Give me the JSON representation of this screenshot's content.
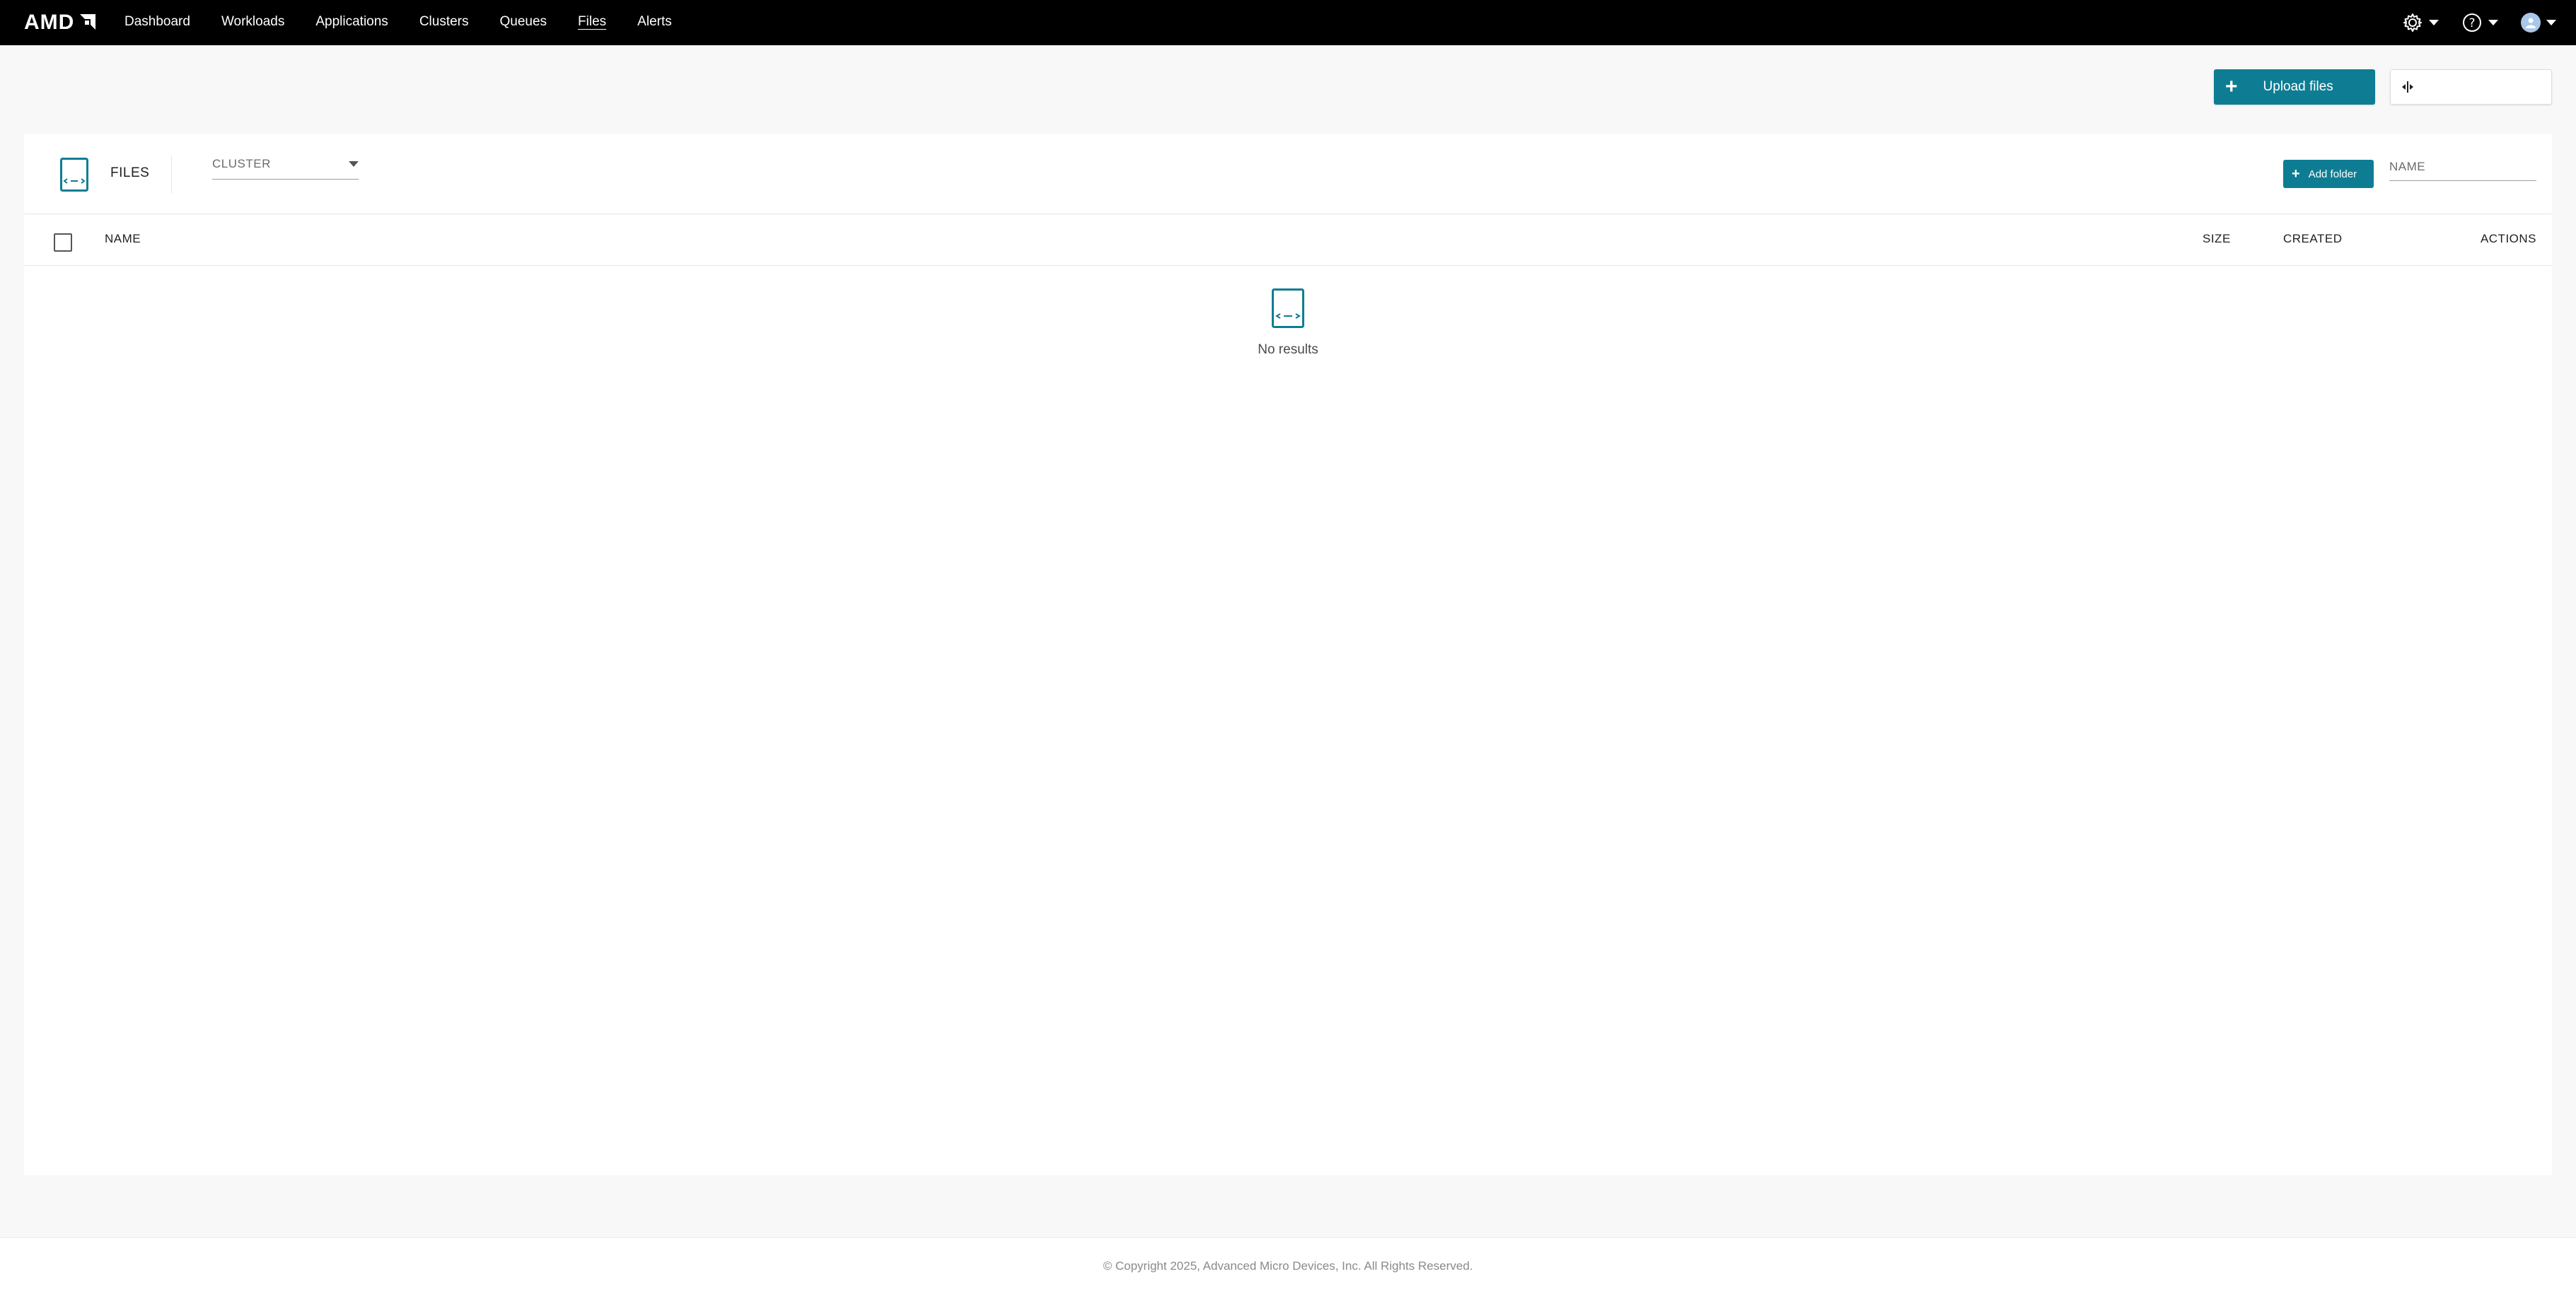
{
  "brand": {
    "logo_text": "AMD",
    "logo_icon": "amd-arrow-logo"
  },
  "nav": {
    "items": [
      {
        "label": "Dashboard",
        "active": false
      },
      {
        "label": "Workloads",
        "active": false
      },
      {
        "label": "Applications",
        "active": false
      },
      {
        "label": "Clusters",
        "active": false
      },
      {
        "label": "Queues",
        "active": false
      },
      {
        "label": "Files",
        "active": true
      },
      {
        "label": "Alerts",
        "active": false
      }
    ],
    "right_icons": [
      "gear-icon",
      "help-icon",
      "avatar"
    ]
  },
  "toolbar": {
    "upload_label": "Upload files",
    "split_icon": "split-view-icon"
  },
  "files_panel": {
    "title": "FILES",
    "cluster_select": {
      "label": "CLUSTER",
      "value": ""
    },
    "add_folder_label": "Add folder",
    "name_filter": {
      "placeholder": "NAME",
      "value": ""
    }
  },
  "table": {
    "columns": {
      "name": "NAME",
      "size": "SIZE",
      "created": "CREATED",
      "actions": "ACTIONS"
    },
    "rows": [],
    "empty_text": "No results"
  },
  "footer": {
    "copyright": "© Copyright 2025, Advanced Micro Devices, Inc. All Rights Reserved."
  },
  "colors": {
    "accent": "#0e7d93",
    "topbar": "#000000",
    "background": "#f8f8f8"
  }
}
